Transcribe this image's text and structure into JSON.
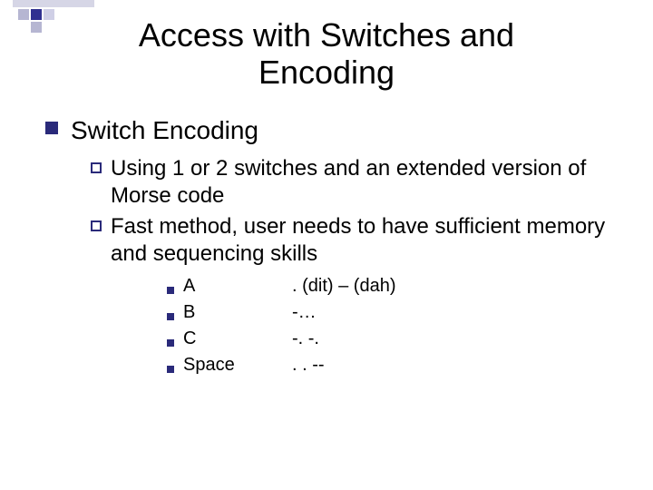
{
  "title_line1": "Access with Switches and",
  "title_line2": "Encoding",
  "heading": "Switch Encoding",
  "sub1": "Using 1 or 2 switches and an extended version of Morse code",
  "sub2": "Fast method, user needs to have sufficient memory and sequencing skills",
  "morse": [
    {
      "letter": "A",
      "code": ". (dit) – (dah)"
    },
    {
      "letter": "B",
      "code": "-…"
    },
    {
      "letter": "C",
      "code": "-. -."
    },
    {
      "letter": "Space",
      "code": ". . --"
    }
  ]
}
